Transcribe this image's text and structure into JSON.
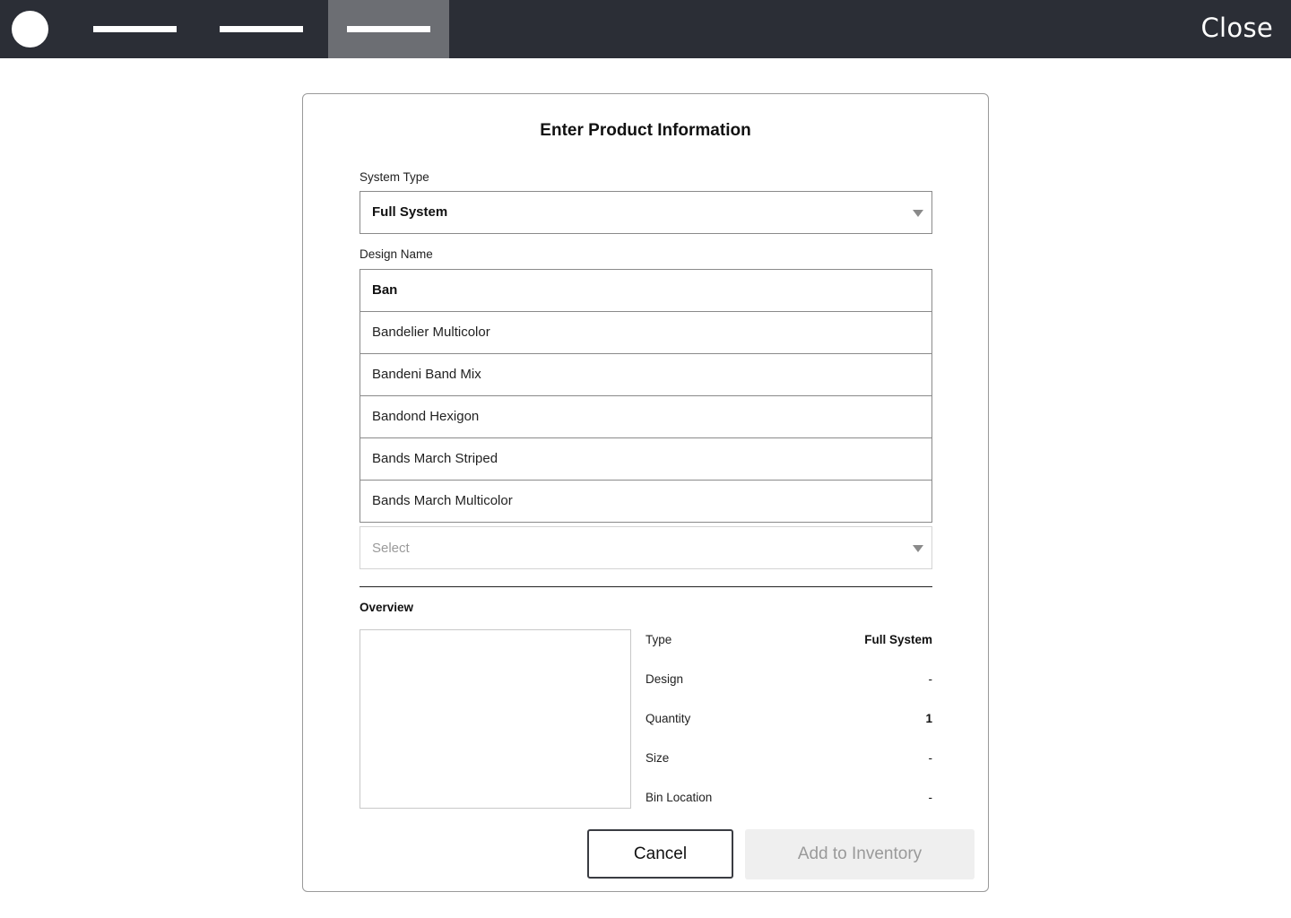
{
  "topbar": {
    "background": "#2b2e36",
    "active_tab_color": "#6c6e73",
    "close_label": "Close"
  },
  "form": {
    "title": "Enter Product Information",
    "system_type": {
      "label": "System Type",
      "value": "Full System"
    },
    "design_name": {
      "label": "Design Name",
      "value": "Ban",
      "suggestions": [
        "Bandelier Multicolor",
        "Bandeni Band Mix",
        "Bandond Hexigon",
        "Bands March Striped",
        "Bands March Multicolor"
      ]
    },
    "size_select": {
      "placeholder": "Select"
    }
  },
  "overview": {
    "heading": "Overview",
    "rows": [
      {
        "key": "Type",
        "value": "Full System"
      },
      {
        "key": "Design",
        "value": "-"
      },
      {
        "key": "Quantity",
        "value": "1"
      },
      {
        "key": "Size",
        "value": "-"
      },
      {
        "key": "Bin Location",
        "value": "-"
      }
    ]
  },
  "actions": {
    "cancel_label": "Cancel",
    "add_label": "Add to Inventory"
  }
}
